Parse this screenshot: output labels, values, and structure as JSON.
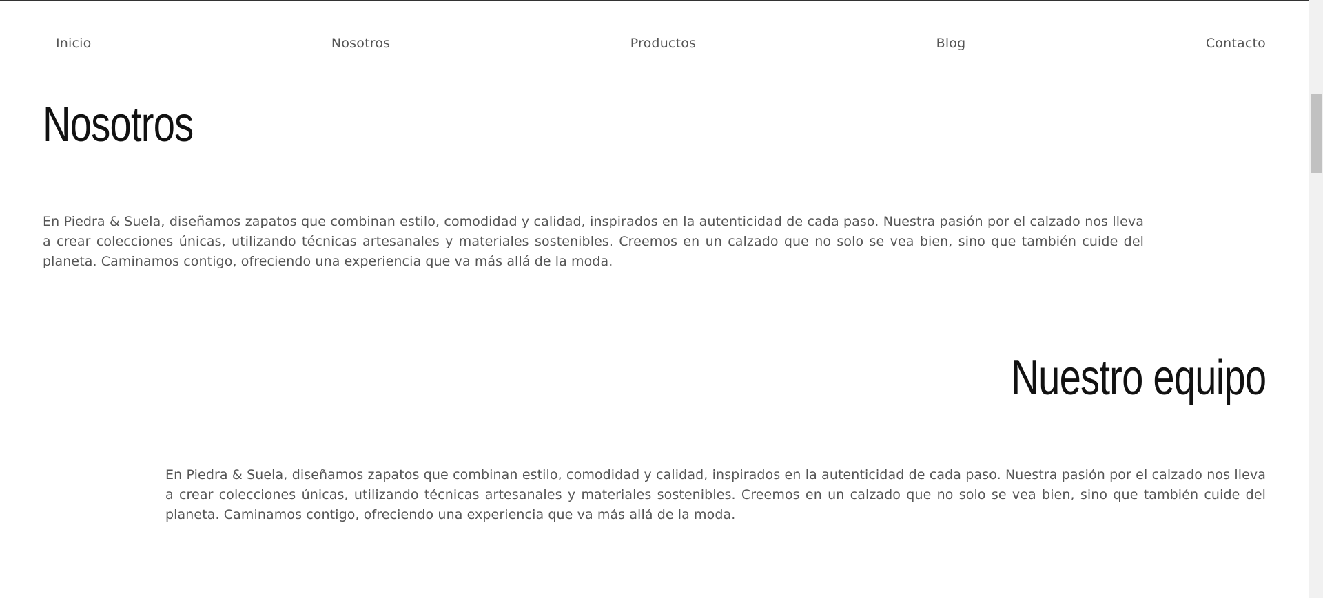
{
  "nav": {
    "items": [
      {
        "label": "Inicio"
      },
      {
        "label": "Nosotros"
      },
      {
        "label": "Productos"
      },
      {
        "label": "Blog"
      },
      {
        "label": "Contacto"
      }
    ]
  },
  "sections": [
    {
      "title": "Nosotros",
      "text": "En Piedra & Suela, diseñamos zapatos que combinan estilo, comodidad y calidad, inspirados en la autenticidad de cada paso. Nuestra pasión por el calzado nos lleva a crear colecciones únicas, utilizando técnicas artesanales y materiales sostenibles. Creemos en un calzado que no solo se vea bien, sino que también cuide del planeta. Caminamos contigo, ofreciendo una experiencia que va más allá de la moda."
    },
    {
      "title": "Nuestro equipo",
      "text": "En Piedra & Suela, diseñamos zapatos que combinan estilo, comodidad y calidad, inspirados en la autenticidad de cada paso. Nuestra pasión por el calzado nos lleva a crear colecciones únicas, utilizando técnicas artesanales y materiales sostenibles. Creemos en un calzado que no solo se vea bien, sino que también cuide del planeta. Caminamos contigo, ofreciendo una experiencia que va más allá de la moda."
    }
  ],
  "scrollbar": {
    "position": 0.16
  }
}
